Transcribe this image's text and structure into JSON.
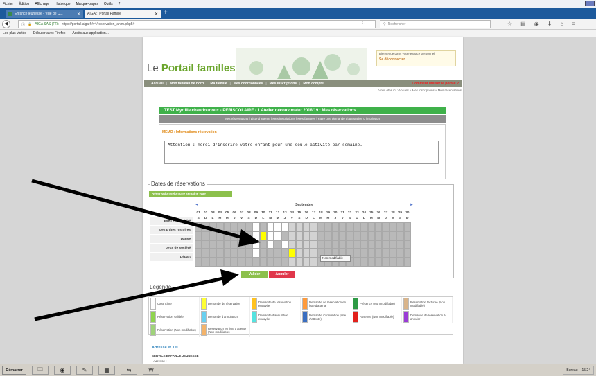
{
  "menubar": {
    "items": [
      "Fichier",
      "Édition",
      "Affichage",
      "Historique",
      "Marque-pages",
      "Outils",
      "?"
    ]
  },
  "tabs": [
    {
      "label": "Enfance jeunesse - Ville de C..."
    },
    {
      "label": "AIGA :: Portail Famille"
    }
  ],
  "newtab": "+",
  "url": {
    "lock": "AIGA SAS (FR)",
    "path": "https://portail.aiga.fr/v4/reservation_anim.php5#"
  },
  "search_placeholder": "Rechercher",
  "bookmarks": [
    "Les plus visités",
    "Débuter avec Firefox",
    "Accès aux application..."
  ],
  "header": {
    "logo_prefix": "Le ",
    "logo_brand": "Portail familles",
    "welcome": "Bienvenue dans votre espace personnel",
    "logout": "Se déconnecter"
  },
  "nav": {
    "items": [
      "Accueil",
      "Mon tableau de bord",
      "Ma famille",
      "Mes coordonnées",
      "Mes inscriptions",
      "Mon compte"
    ],
    "help": "Comment utiliser le portail ?"
  },
  "breadcrumb": "Vous êtes ici : Accueil » Mes inscriptions » Mes réservations",
  "reservation": {
    "title": "TEST Myrtille chaudoudoux - PERISCOLAIRE - 1 Atelier découv mater 2018/19 : Mes réservations",
    "subnav": "Mes réservations | Liste d'attente | Mes inscriptions | Mes factures | Faire une demande d'attestation d'inscription"
  },
  "memo": {
    "title": "MEMO : Informations réservation",
    "text": "Attention : merci d'inscrire votre enfant pour une seule activité par semaine."
  },
  "dates": {
    "legend": "Dates de réservations",
    "type_button": "Réservation selon une semaine type",
    "month": "Septembre",
    "prev": "◄",
    "next": "►",
    "days": [
      "01",
      "02",
      "03",
      "04",
      "05",
      "06",
      "07",
      "08",
      "09",
      "10",
      "11",
      "12",
      "13",
      "14",
      "15",
      "16",
      "17",
      "18",
      "19",
      "20",
      "21",
      "22",
      "23",
      "24",
      "25",
      "26",
      "27",
      "28",
      "29",
      "30"
    ],
    "day_letters": [
      "S",
      "D",
      "L",
      "M",
      "M",
      "J",
      "V",
      "S",
      "D",
      "L",
      "M",
      "M",
      "J",
      "V",
      "S",
      "D",
      "L",
      "M",
      "M",
      "J",
      "V",
      "S",
      "D",
      "L",
      "M",
      "M",
      "J",
      "V",
      "S",
      "D"
    ],
    "activities": [
      "Eveil et motricité",
      "Les p'tites histoires",
      "Danse",
      "Jeux de société",
      "Départ"
    ],
    "tooltip": "Non modifiable"
  },
  "buttons": {
    "valider": "Valider",
    "annuler": "Annuler"
  },
  "legende": {
    "title": "Légende",
    "items": [
      {
        "label": "Case Libre",
        "color": "#ffffff"
      },
      {
        "label": "Demande de réservation",
        "color": "#ffff33"
      },
      {
        "label": "Demande de réservation envoyée",
        "color": "#ffc21f"
      },
      {
        "label": "Demande de réservation en liste d'attente",
        "color": "#ff9a3a"
      },
      {
        "label": "Présence (Non modifiable)",
        "color": "#2e9a45"
      },
      {
        "label": "Réservation facturée (Non modifiable)",
        "color": "#d9b48a"
      },
      {
        "label": "Réservation validée",
        "color": "#8fd44e"
      },
      {
        "label": "Demande d'annulation",
        "color": "#69d0f0"
      },
      {
        "label": "Demande d'annulation envoyée",
        "color": "#55e3e0"
      },
      {
        "label": "Demande d'annulation (liste d'attente)",
        "color": "#3a6ec0"
      },
      {
        "label": "Absence (Non modifiable)",
        "color": "#e2211c"
      },
      {
        "label": "Demande de réservation à annuler",
        "color": "#9a3bd6"
      },
      {
        "label": "Réservation (Non modifiable)",
        "color": "#9fd27a"
      },
      {
        "label": "Réservation en liste d'attente (Non modifiable)",
        "color": "#f3b36a"
      }
    ]
  },
  "address": {
    "title": "Adresse et Tél",
    "service": "SERVICE ENFANCE JEUNESSE",
    "line": "- Adresse :"
  },
  "taskbar": {
    "start": "Démarrer",
    "tray": "Bureau",
    "clock": "15:24"
  }
}
